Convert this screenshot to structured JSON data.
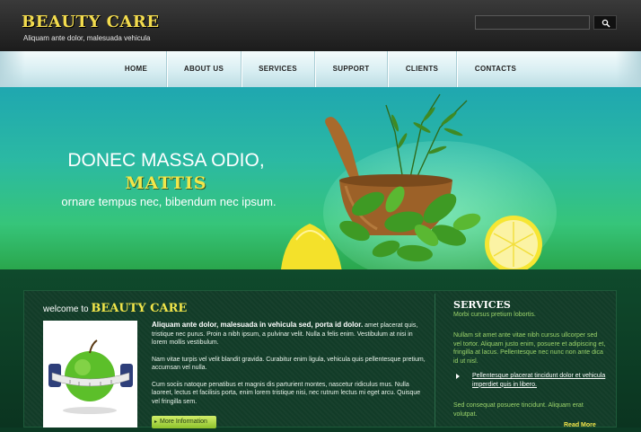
{
  "header": {
    "logo": "BEAUTY CARE",
    "tagline": "Aliquam ante dolor, malesuada vehicula",
    "search_placeholder": "",
    "search_icon": "search-icon"
  },
  "nav": {
    "items": [
      "HOME",
      "ABOUT US",
      "SERVICES",
      "SUPPORT",
      "CLIENTS",
      "CONTACTS"
    ]
  },
  "hero": {
    "line1": "DONEC MASSA ODIO,",
    "line2": "MATTIS",
    "line3": "ornare tempus nec, bibendum nec ipsum."
  },
  "welcome": {
    "prefix": "welcome to",
    "brand": "BEAUTY CARE",
    "para1_bold": "Aliquam ante dolor, malesuada in vehicula sed, porta id dolor.",
    "para1_rest": " amet placerat quis, tristique nec purus. Proin a nibh ipsum, a pulvinar velit. Nulla a felis enim. Vestibulum at nisi in lorem mollis vestibulum.",
    "para2": "Nam vitae turpis vel velit blandit gravida. Curabitur enim ligula, vehicula quis pellentesque pretium, accumsan vel nulla.",
    "para3": "Cum sociis natoque penatibus et magnis dis parturient montes, nascetur ridiculus mus. Nulla laoreet, lectus et facilisis porta, enim lorem tristique nisi, nec rutrum lectus mi eget arcu. Quisque vel fringilla sem.",
    "more_button": "More Information"
  },
  "services": {
    "title": "SERVICES",
    "subtitle": "Morbi cursus pretium lobortis.",
    "text1": "Nullam sit amet ante vitae nibh cursus ullcorper sed vel tortor. Aliquam justo enim, posuere et adipiscing et, fringilla at lacus. Pellentesque nec nunc non ante dica id ut nisl.",
    "links": [
      "Pellentesque placerat tincidunt dolor et vehicula imperdiet quis in libero."
    ],
    "text2": "Sed consequat posuere tincidunt. Aliquam erat volutpat.",
    "more": "Read More"
  },
  "colors": {
    "brand_yellow": "#f2e64a",
    "accent_green": "#9bd36a",
    "panel_dark": "#123c28"
  }
}
